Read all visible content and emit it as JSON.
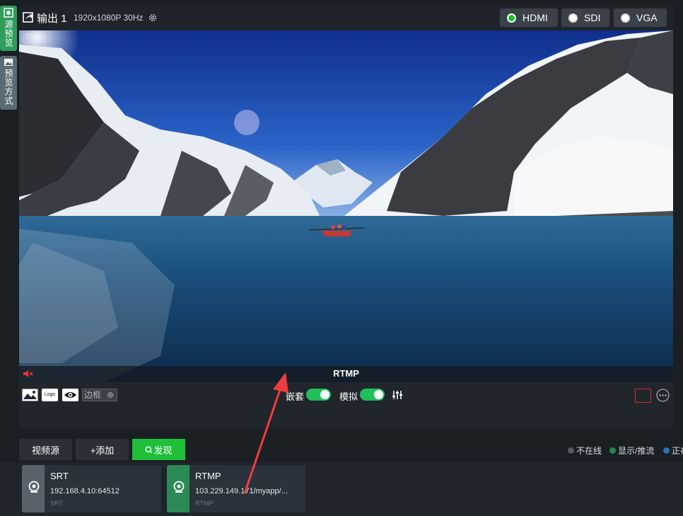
{
  "sidebar": {
    "tab_source_preview": "源预览",
    "tab_preview_mode": "预览方式"
  },
  "output": {
    "title": "输出 1",
    "resolution": "1920x1080P 30Hz",
    "ports": [
      {
        "label": "HDMI",
        "selected": true
      },
      {
        "label": "SDI",
        "selected": false
      },
      {
        "label": "VGA",
        "selected": false
      }
    ],
    "video_label": "RTMP",
    "video_watermark": "RTMP"
  },
  "controls": {
    "logo_label": "Logo",
    "border_label": "边框",
    "embed_label": "嵌套",
    "embed_on": true,
    "analog_label": "模拟",
    "analog_on": true
  },
  "bottom": {
    "video_source_button": "视频源",
    "add_button": "+添加",
    "discover_button": "发现",
    "legend": [
      {
        "label": "不在线",
        "color": "#555b60"
      },
      {
        "label": "显示/推流",
        "color": "#1f8a4c"
      },
      {
        "label": "正在",
        "color": "#2f6fb8"
      }
    ],
    "sources": [
      {
        "name": "SRT",
        "address": "192.168.4.10:64512",
        "protocol": "SRT",
        "status_color": "#59616a"
      },
      {
        "name": "RTMP",
        "address": "103.229.149.171/myapp/...",
        "protocol": "RTMP",
        "status_color": "#2b8a55"
      }
    ]
  },
  "colors": {
    "accent_green": "#1fbf5c",
    "discover_green": "#1fbf3a",
    "record_red": "#d12f2f",
    "annotation_arrow": "#f03c3c"
  }
}
